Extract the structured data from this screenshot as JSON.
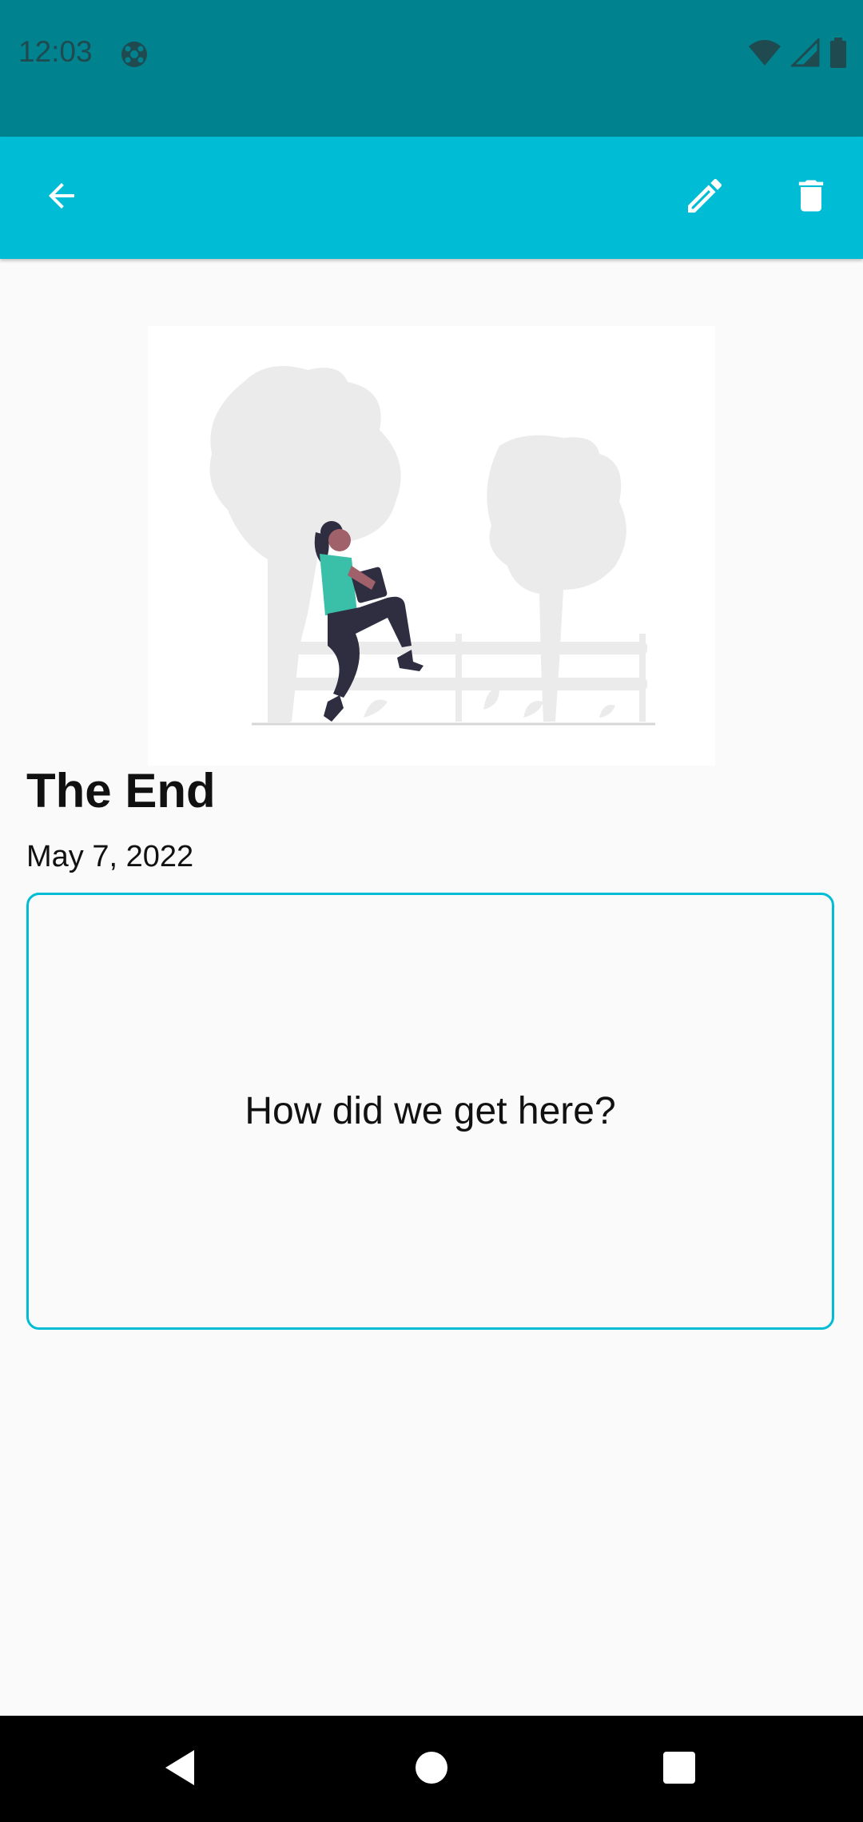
{
  "status_bar": {
    "time": "12:03",
    "background": "#00838f",
    "icons": [
      "app-notification-icon",
      "wifi-icon",
      "signal-icon",
      "battery-icon"
    ]
  },
  "app_bar": {
    "background": "#00bcd4",
    "back_icon": "arrow-back-icon",
    "edit_icon": "pencil-icon",
    "delete_icon": "trash-icon"
  },
  "entry": {
    "title": "The End",
    "date": "May 7, 2022",
    "content": "How did we get here?",
    "accent": "#00bcd4"
  },
  "nav_bar": {
    "icons": [
      "nav-back-icon",
      "nav-home-icon",
      "nav-recents-icon"
    ]
  }
}
